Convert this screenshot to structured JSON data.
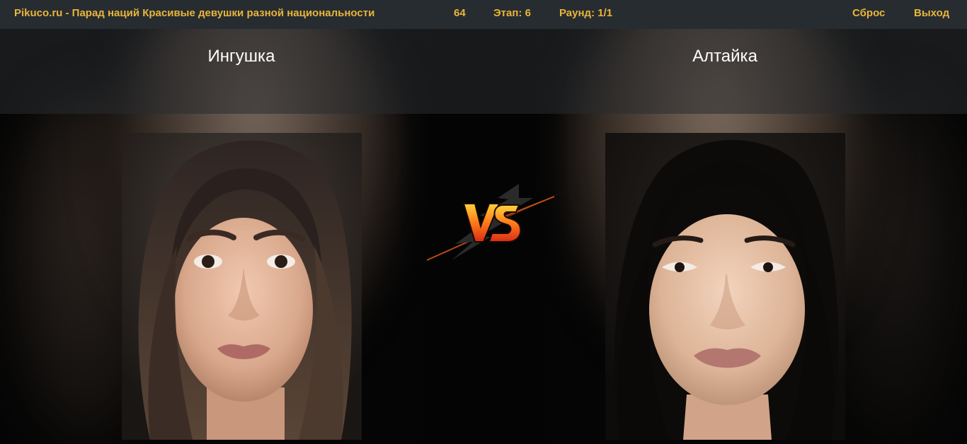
{
  "header": {
    "title": "Pikuco.ru - Парад наций Красивые девушки разной национальности",
    "count": "64",
    "stage": "Этап: 6",
    "round": "Раунд: 1/1",
    "reset_label": "Сброс",
    "exit_label": "Выход",
    "accent_color": "#e8b53a",
    "bar_color": "#272c31"
  },
  "contestants": [
    {
      "name": "Ингушка",
      "photo": "portrait-woman-dark-brown-hair"
    },
    {
      "name": "Алтайка",
      "photo": "portrait-woman-black-hair"
    }
  ],
  "versus": {
    "icon": "vs-lightning-icon"
  }
}
